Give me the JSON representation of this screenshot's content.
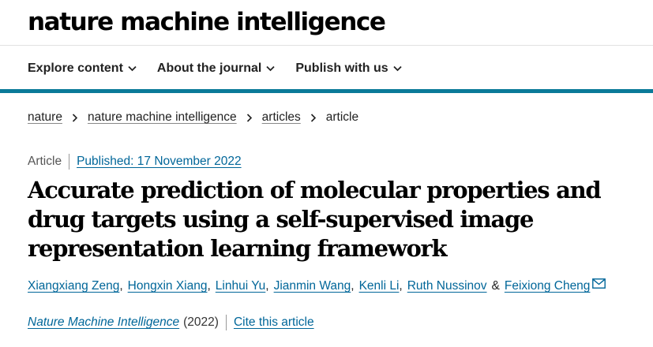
{
  "header": {
    "logo_text": "nature machine intelligence"
  },
  "nav": {
    "items": [
      {
        "label": "Explore content"
      },
      {
        "label": "About the journal"
      },
      {
        "label": "Publish with us"
      }
    ]
  },
  "colors": {
    "accent_bar": "#0a7a99",
    "link": "#006699"
  },
  "breadcrumb": {
    "items": [
      "nature",
      "nature machine intelligence",
      "articles"
    ],
    "current": "article"
  },
  "article": {
    "type": "Article",
    "published": "Published: 17 November 2022",
    "title": "Accurate prediction of molecular properties and drug targets using a self-supervised image representation learning framework",
    "authors": [
      "Xiangxiang Zeng",
      "Hongxin Xiang",
      "Linhui Yu",
      "Jianmin Wang",
      "Kenli Li",
      "Ruth Nussinov",
      "Feixiong Cheng"
    ],
    "author_separator": ",",
    "author_amp": "&",
    "contact_icon": "envelope-icon",
    "journal": "Nature Machine Intelligence",
    "year": "(2022)",
    "cite_label": "Cite this article"
  }
}
